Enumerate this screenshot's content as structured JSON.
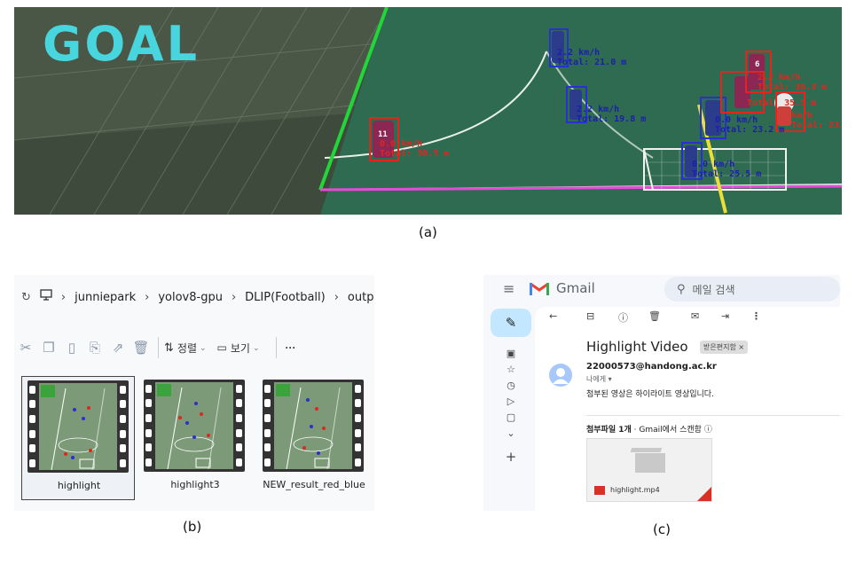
{
  "labels": {
    "a": "(a)",
    "b": "(b)",
    "c": "(c)"
  },
  "panel_a": {
    "overlay_text": "GOAL",
    "colors": {
      "goal_text": "#48d6de",
      "team_blue": "#2a2fd0",
      "team_red": "#e0261e"
    },
    "tracks": [
      {
        "team": "blue",
        "speed": "2.2 km/h",
        "total": "Total: 21.0 m"
      },
      {
        "team": "blue",
        "speed": "2.2 km/h",
        "total": "Total: 19.8 m"
      },
      {
        "team": "blue",
        "speed": "0.0 km/h",
        "total": "Total: 23.2 m"
      },
      {
        "team": "blue",
        "speed": "0.0 km/h",
        "total": "Total: 25.5 m"
      },
      {
        "team": "red",
        "speed": "0.0 km/h",
        "total": "Total: 30.3 m"
      },
      {
        "team": "red",
        "speed": "2.2 km/h",
        "total": "Total: 36.3 m"
      },
      {
        "team": "red",
        "speed": "km/h",
        "total": "Total: 23.9"
      },
      {
        "team": "red",
        "speed": "",
        "total": "Total: 35.5 m"
      }
    ],
    "jersey_numbers": [
      "11",
      "6"
    ]
  },
  "panel_b": {
    "breadcrumb": [
      "junniepark",
      "yolov8-gpu",
      "DLIP(Football)",
      "output_video"
    ],
    "sort_label": "정렬",
    "view_label": "보기",
    "more_label": "···",
    "files": [
      {
        "name": "highlight",
        "selected": true
      },
      {
        "name": "highlight3",
        "selected": false
      },
      {
        "name": "NEW_result_red_blue",
        "selected": false
      }
    ]
  },
  "panel_c": {
    "app_name": "Gmail",
    "search_placeholder": "메일 검색",
    "subject": "Highlight Video",
    "label_chip": "받은편지함 ×",
    "sender": "22000573@handong.ac.kr",
    "recipient": "나에게",
    "body": "첨부된 영상은 하이라이트 영상입니다.",
    "attachments_title": "첨부파일 1개",
    "attachments_scan": "Gmail에서 스캔함",
    "attachment_name": "highlight.mp4",
    "colors": {
      "compose_bg": "#c2e7ff",
      "logo_red": "#ea4335"
    }
  }
}
